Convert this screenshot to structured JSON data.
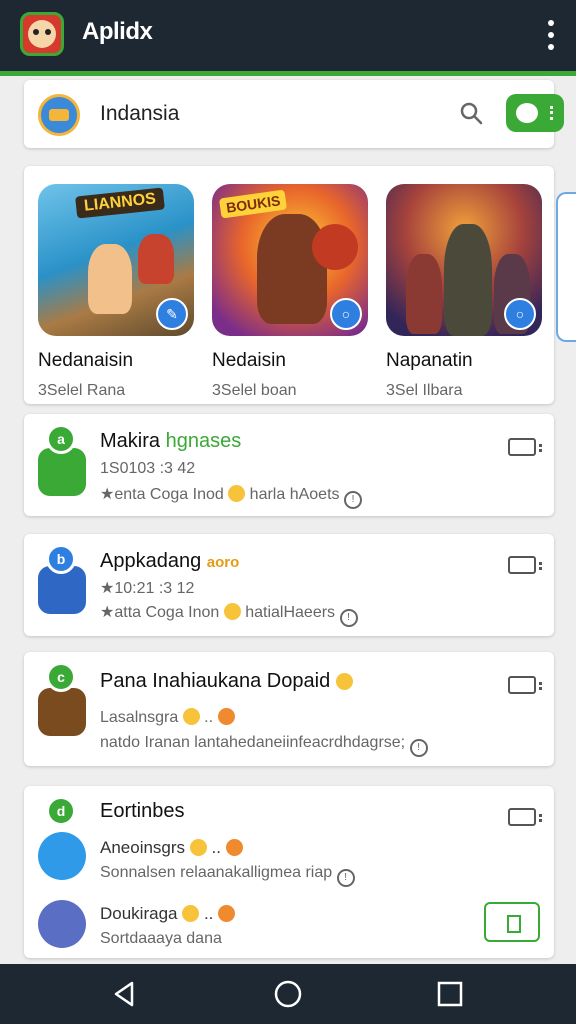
{
  "app": {
    "title": "Aplidx"
  },
  "search": {
    "label": "Indansia"
  },
  "games": [
    {
      "tag": "LIANNOS",
      "name": "Nedanaisin",
      "sub": "3Selel Rana"
    },
    {
      "tag": "BOUKIS",
      "name": "Nedaisin",
      "sub": "3Selel boan"
    },
    {
      "tag": "",
      "name": "Napanatin",
      "sub": "3Sel Ilbara"
    }
  ],
  "feed": [
    {
      "badge": "a",
      "title": "Makira",
      "title_hl": "hgnases",
      "line1": "1S0103 :3 42",
      "line2a": "★enta Coga Inod",
      "line2b": "harla hAoets"
    },
    {
      "badge": "b",
      "title": "Appkadang",
      "title_hl": "aoro",
      "line1": "★10:21 :3 12",
      "line2a": "★atta Coga Inon",
      "line2b": "hatialHaeers"
    },
    {
      "badge": "c",
      "title": "Pana Inahiaukana Dopaid",
      "line1": "Lasalnsgra",
      "line2": "natdo Iranan lantahedaneiinfeacrdhdagrse;"
    },
    {
      "badge": "d",
      "title": "Eortinbes",
      "sub1_title": "Aneoinsgrs",
      "sub1_line": "Sonnalsen relaanakalligmea riap",
      "sub2_title": "Doukiraga",
      "sub2_line": "Sortdaaaya dana"
    }
  ]
}
